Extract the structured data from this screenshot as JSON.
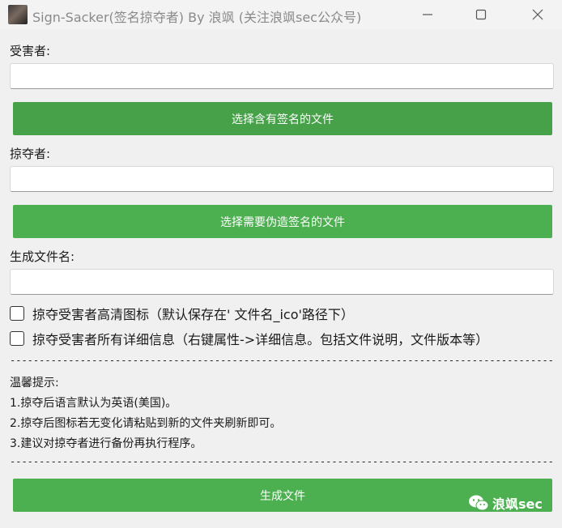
{
  "window": {
    "title": "Sign-Sacker(签名掠夺者) By 浪飒 (关注浪飒sec公众号)"
  },
  "victim": {
    "label": "受害者:",
    "value": "",
    "button": "选择含有签名的文件"
  },
  "plunderer": {
    "label": "掠夺者:",
    "value": "",
    "button": "选择需要伪造签名的文件"
  },
  "output": {
    "label": "生成文件名:",
    "value": ""
  },
  "options": [
    {
      "label": "掠夺受害者高清图标（默认保存在' 文件名_ico'路径下）",
      "checked": false
    },
    {
      "label": "掠夺受害者所有详细信息（右键属性->详细信息。包括文件说明，文件版本等）",
      "checked": false
    }
  ],
  "divider": "----------------------------------------------------------------------------------------------------------",
  "tips": {
    "title": "温馨提示:",
    "lines": [
      "1.掠夺后语言默认为英语(美国)。",
      "2.掠夺后图标若无变化请粘贴到新的文件夹刷新即可。",
      "3.建议对掠夺者进行备份再执行程序。"
    ]
  },
  "generate_button": "生成文件",
  "watermark": "浪飒sec",
  "colors": {
    "button_green": "#4caf50",
    "window_bg": "#f0f0f0"
  },
  "icons": {
    "app": "app-avatar-icon",
    "minimize": "minimize-icon",
    "maximize": "maximize-icon",
    "close": "close-icon",
    "watermark": "wechat-icon"
  }
}
